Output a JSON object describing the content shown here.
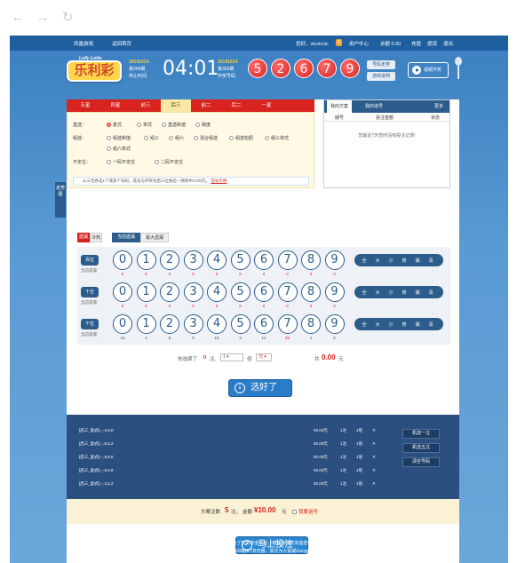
{
  "browser": {
    "back_glyph": "←",
    "forward_glyph": "→",
    "reload_glyph": "↻"
  },
  "topnav": {
    "site": "凤凰游戏",
    "home": "返回首页",
    "greeting": "您好，vicvicvic",
    "msg_count": "0",
    "user_center": "用户中心",
    "balance": "余额 0.00",
    "recharge": "充值",
    "withdraw": "提现",
    "logout": "退出"
  },
  "header": {
    "logo_top": "Lolly Lotto",
    "logo_main": "乐利彩",
    "current_issue_date": "20141014",
    "current_issue_no": "第304期",
    "current_issue_label": "停止时间",
    "countdown": "04:01",
    "last_issue_date": "20141014",
    "last_issue_no": "第303期",
    "last_issue_label": "开奖号码",
    "draw_numbers": [
      "5",
      "2",
      "6",
      "7",
      "9"
    ],
    "trend_btn": "号码走势",
    "rules_btn": "游戏说明",
    "video_btn": "视频开奖"
  },
  "play_tabs": [
    "五星",
    "四星",
    "前三",
    "后三",
    "前二",
    "后二",
    "一星"
  ],
  "play_tab_active": 3,
  "options": {
    "direct_label": "直选：",
    "direct": [
      "复式",
      "单式",
      "直选和值",
      "跨度"
    ],
    "group_label": "组选：",
    "group_row1": [
      "组选和值",
      "组三",
      "组六",
      "混合组选",
      "组选包胆",
      "组三单式"
    ],
    "group_row2": [
      "组六单式"
    ],
    "nopos_label": "不定位：",
    "nopos": [
      "一码不定位",
      "二码不定位"
    ],
    "note": "从三位各选1个或多个号码，选号与开奖号后三位按位一致即中1700元。",
    "note_link": "选号示例"
  },
  "my_plan": {
    "tabs": [
      "我的方案",
      "我的追号",
      "更多"
    ],
    "cols": [
      "期号",
      "投注金额",
      "状态"
    ],
    "empty": "您最近7天暂时没有投注记录!"
  },
  "side_widget": "走势图",
  "miss_bar": {
    "miss": "遗漏",
    "hot": "冷热",
    "current": "当前遗漏",
    "max": "最大遗漏"
  },
  "picker_rows": [
    {
      "label": "百位",
      "sub": "当前遗漏",
      "miss": [
        "0",
        "0",
        "0",
        "0",
        "0",
        "0",
        "0",
        "0",
        "0",
        "0"
      ],
      "red": [
        0,
        1,
        2,
        3,
        4,
        5,
        6,
        7,
        8,
        9
      ]
    },
    {
      "label": "十位",
      "sub": "当前遗漏",
      "miss": [
        "0",
        "0",
        "0",
        "0",
        "0",
        "0",
        "0",
        "0",
        "0",
        "0"
      ],
      "red": [
        0,
        1,
        2,
        3,
        4,
        5,
        6,
        7,
        8,
        9
      ]
    },
    {
      "label": "个位",
      "sub": "当前遗漏",
      "miss": [
        "15",
        "2",
        "8",
        "9",
        "16",
        "3",
        "12",
        "25",
        "1",
        "0"
      ],
      "red": [
        7
      ]
    }
  ],
  "digits": [
    "0",
    "1",
    "2",
    "3",
    "4",
    "5",
    "6",
    "7",
    "8",
    "9"
  ],
  "quick_picks": [
    "全",
    "大",
    "小",
    "奇",
    "偶",
    "清"
  ],
  "summary": {
    "pre": "你选择了",
    "count": "0",
    "unit": "注,",
    "multiple": "1",
    "times": "倍",
    "yuan": "元",
    "total_pre": "共",
    "total": "0.00",
    "total_unit": "元"
  },
  "select_btn": "选好了",
  "cart": [
    {
      "play": "[后三_复式]-,-,3,9,0",
      "amount": "¥2.00元",
      "count": "1注",
      "times": "1倍"
    },
    {
      "play": "[后三_复式]-,-,6,5,2",
      "amount": "¥2.00元",
      "count": "1注",
      "times": "1倍"
    },
    {
      "play": "[后三_复式]-,-,5,6,6",
      "amount": "¥2.00元",
      "count": "1注",
      "times": "1倍"
    },
    {
      "play": "[后三_复式]-,-,6,0,9",
      "amount": "¥2.00元",
      "count": "1注",
      "times": "1倍"
    },
    {
      "play": "[后三_复式]-,-,3,4,2",
      "amount": "¥2.00元",
      "count": "1注",
      "times": "1倍"
    }
  ],
  "cart_side": [
    "机选一注",
    "机选五注",
    "清空号码"
  ],
  "totals": {
    "pre": "方案注数",
    "count": "5",
    "unit": "注，",
    "amount_label": "金额",
    "amount": "¥10.00",
    "amount_unit": "元",
    "chase": "我要追号"
  },
  "bet_btn": "马上投注",
  "footer": [
    "资金安全提示：为了您的资金安全，建议您绑定资金密码。",
    "浏览器建议：推荐为IE8或IE7浏览器，其次为火狐或Google浏览器"
  ]
}
